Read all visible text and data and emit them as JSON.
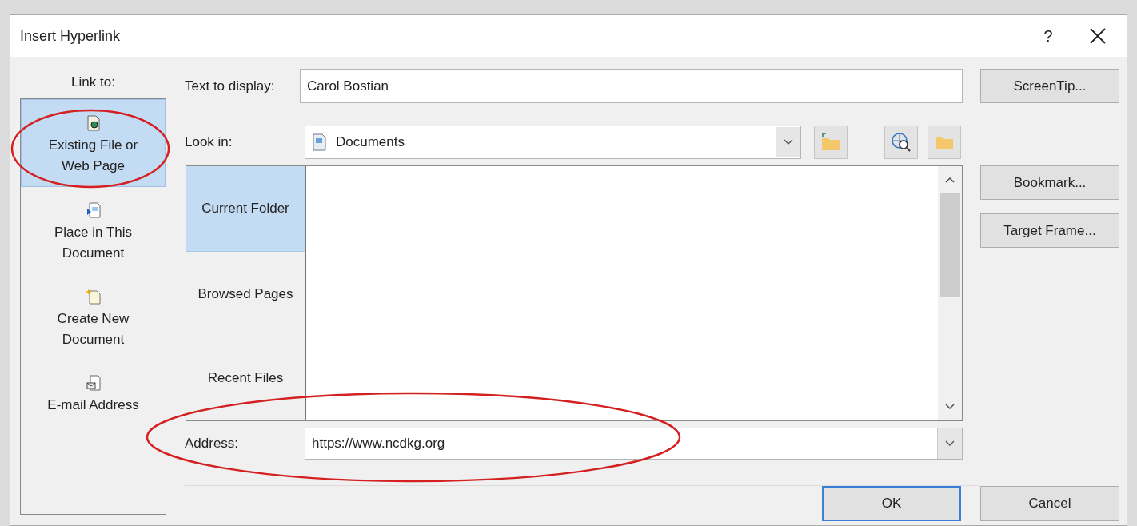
{
  "window": {
    "title": "Insert Hyperlink",
    "help": "?"
  },
  "link_to": {
    "label": "Link to:",
    "items": [
      {
        "label": "Existing File or Web Page",
        "kind": "file",
        "selected": true,
        "circled": true
      },
      {
        "label": "Place in This Document",
        "kind": "place",
        "selected": false,
        "circled": false
      },
      {
        "label": "Create New Document",
        "kind": "new",
        "selected": false,
        "circled": false
      },
      {
        "label": "E-mail Address",
        "kind": "email",
        "selected": false,
        "circled": false
      }
    ]
  },
  "text_to_display": {
    "label": "Text to display:",
    "value": "Carol Bostian"
  },
  "look_in": {
    "label": "Look in:",
    "value": "Documents"
  },
  "browse_tabs": [
    {
      "label": "Current Folder",
      "selected": true
    },
    {
      "label": "Browsed Pages",
      "selected": false
    },
    {
      "label": "Recent Files",
      "selected": false
    }
  ],
  "address": {
    "label": "Address:",
    "value": "https://www.ncdkg.org",
    "circled": true
  },
  "side_buttons": [
    "ScreenTip...",
    "Bookmark...",
    "Target Frame..."
  ],
  "buttons": [
    {
      "label": "OK",
      "kind": "default"
    },
    {
      "label": "Cancel",
      "kind": "normal"
    }
  ]
}
